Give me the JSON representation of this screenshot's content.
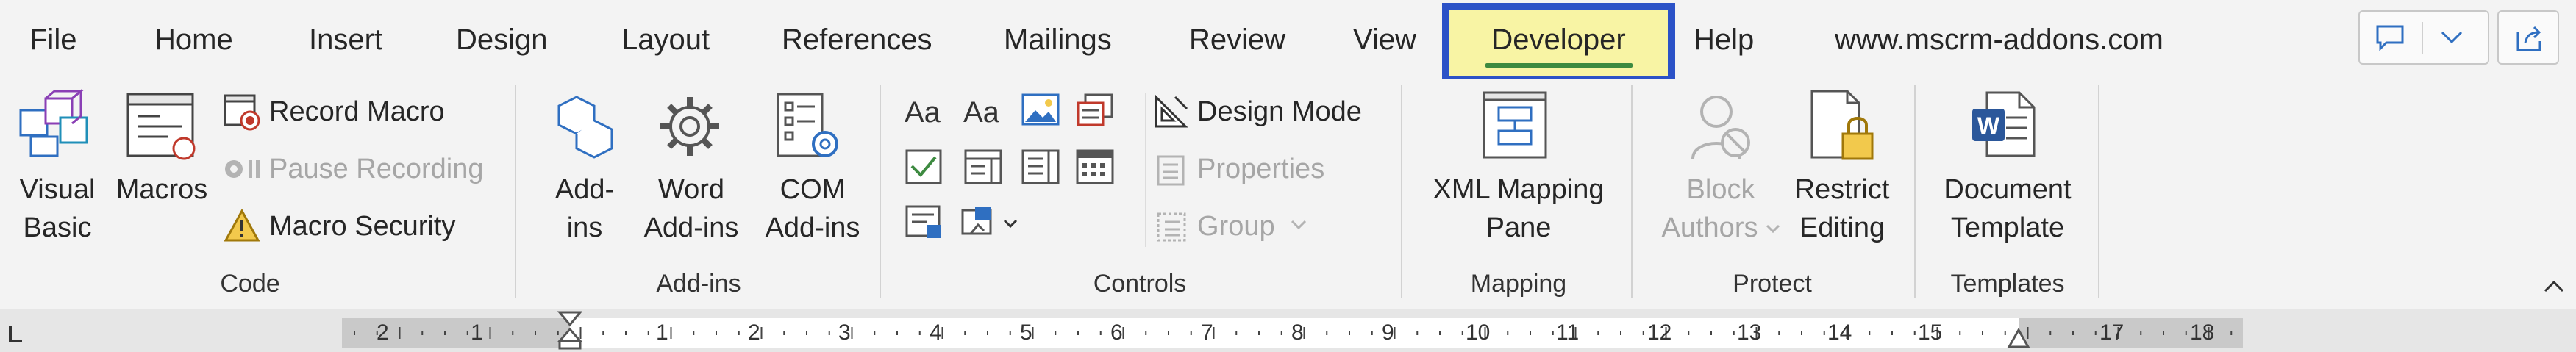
{
  "tabs": [
    {
      "label": "File"
    },
    {
      "label": "Home"
    },
    {
      "label": "Insert"
    },
    {
      "label": "Design"
    },
    {
      "label": "Layout"
    },
    {
      "label": "References"
    },
    {
      "label": "Mailings"
    },
    {
      "label": "Review"
    },
    {
      "label": "View"
    },
    {
      "label": "Developer",
      "active": true
    },
    {
      "label": "Help"
    },
    {
      "label": "www.mscrm-addons.com"
    }
  ],
  "top_right": {
    "comments_icon": "comment-icon",
    "dropdown_icon": "chevron-down-icon",
    "share_icon": "share-icon"
  },
  "groups": {
    "code": {
      "label": "Code",
      "visual_basic": {
        "line1": "Visual",
        "line2": "Basic"
      },
      "macros": {
        "label": "Macros"
      },
      "record_macro": "Record Macro",
      "pause_recording": "Pause Recording",
      "macro_security": "Macro Security"
    },
    "addins": {
      "label": "Add-ins",
      "addins_btn": {
        "line1": "Add-",
        "line2": "ins"
      },
      "word_addins": {
        "line1": "Word",
        "line2": "Add-ins"
      },
      "com_addins": {
        "line1": "COM",
        "line2": "Add-ins"
      }
    },
    "controls": {
      "label": "Controls",
      "design_mode": "Design Mode",
      "properties": "Properties",
      "group": "Group"
    },
    "mapping": {
      "label": "Mapping",
      "xml_mapping": {
        "line1": "XML Mapping",
        "line2": "Pane"
      }
    },
    "protect": {
      "label": "Protect",
      "block_authors": {
        "line1": "Block",
        "line2": "Authors"
      },
      "restrict_editing": {
        "line1": "Restrict",
        "line2": "Editing"
      }
    },
    "templates": {
      "label": "Templates",
      "document_template": {
        "line1": "Document",
        "line2": "Template"
      }
    }
  },
  "ruler": {
    "numbers": [
      "2",
      "1",
      "1",
      "2",
      "3",
      "4",
      "5",
      "6",
      "7",
      "8",
      "9",
      "10",
      "11",
      "12",
      "13",
      "14",
      "15",
      "17",
      "18"
    ]
  },
  "colors": {
    "accent_highlight": "#f8f4a4",
    "highlight_border": "#2b52c7",
    "active_underline": "#3d8a40",
    "icon_blue": "#2f6fc1"
  }
}
